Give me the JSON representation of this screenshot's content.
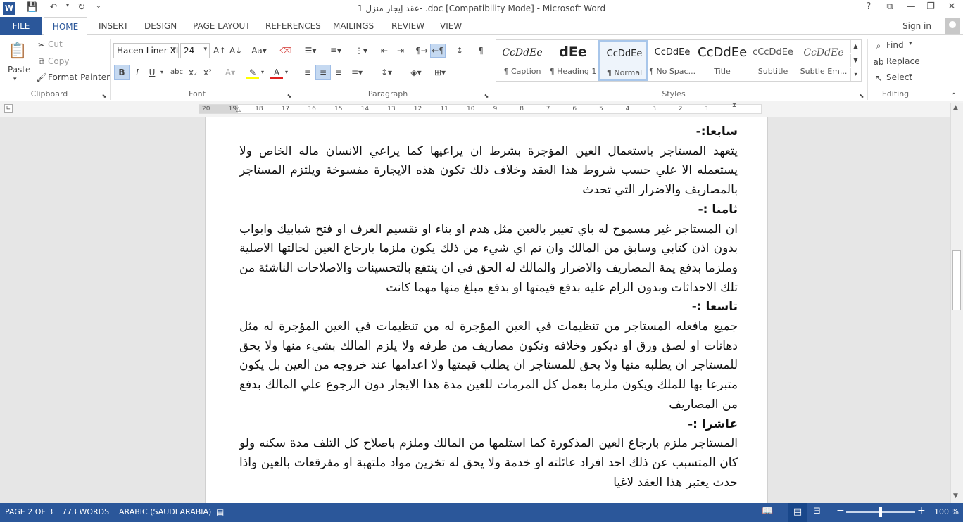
{
  "window": {
    "title": "عقد إيجار منزل 1- .doc [Compatibility Mode] - Microsoft Word",
    "qat_icons": [
      "word-app-icon",
      "save-icon",
      "undo-icon",
      "redo-icon",
      "customize-icon"
    ],
    "controls": {
      "help": "?",
      "ribbon_options": "⧉",
      "minimize": "—",
      "maximize": "❐",
      "close": "✕"
    }
  },
  "tabs": {
    "file": "FILE",
    "home": "HOME",
    "insert": "INSERT",
    "design": "DESIGN",
    "page_layout": "PAGE LAYOUT",
    "references": "REFERENCES",
    "mailings": "MAILINGS",
    "review": "REVIEW",
    "view": "VIEW",
    "sign_in": "Sign in"
  },
  "ribbon": {
    "clipboard": {
      "label": "Clipboard",
      "paste": "Paste",
      "cut": "Cut",
      "copy": "Copy",
      "format_painter": "Format Painter"
    },
    "font": {
      "label": "Font",
      "font_name": "Hacen Liner XL",
      "font_size": "24",
      "bold": "B",
      "italic": "I",
      "underline": "U",
      "strike": "abc",
      "subscript": "x₂",
      "superscript": "x²"
    },
    "paragraph": {
      "label": "Paragraph"
    },
    "styles": {
      "label": "Styles",
      "items": [
        {
          "preview": "CcDdEe",
          "name": "¶ Caption"
        },
        {
          "preview": "dEe",
          "name": "¶ Heading 1"
        },
        {
          "preview": "CcDdEe",
          "name": "¶ Normal"
        },
        {
          "preview": "CcDdEe",
          "name": "¶ No Spac..."
        },
        {
          "preview": "CcDdEe",
          "name": "Title"
        },
        {
          "preview": "cCcDdEe",
          "name": "Subtitle"
        },
        {
          "preview": "CcDdEe",
          "name": "Subtle Em..."
        }
      ]
    },
    "editing": {
      "label": "Editing",
      "find": "Find",
      "replace": "Replace",
      "select": "Select"
    }
  },
  "ruler": {
    "ticks": [
      "20",
      "19",
      "18",
      "17",
      "16",
      "15",
      "14",
      "13",
      "12",
      "11",
      "10",
      "9",
      "8",
      "7",
      "6",
      "5",
      "4",
      "3",
      "2",
      "1"
    ]
  },
  "document": {
    "paragraphs": [
      {
        "kind": "head",
        "text": "سابعا:-"
      },
      {
        "kind": "body",
        "text": "يتعهد المستاجر باستعمال العين المؤجرة بشرط ان يراعيها كما يراعي الانسان ماله الخاص ولا يستعمله الا علي حسب شروط هذا العقد وخلاف ذلك تكون هذه الايجارة مفسوخة ويلتزم المستاجر بالمصاريف والاضرار التي تحدث"
      },
      {
        "kind": "head",
        "text": "ثامنا :-"
      },
      {
        "kind": "body",
        "text": "ان المستاجر غير مسموح له باي تغيير بالعين مثل هدم او بناء او تقسيم الغرف او فتح شبابيك وابواب بدون اذن كتابي وسابق من المالك وان تم اي شيء من ذلك يكون ملزما بارجاع العين لحالتها الاصلية وملزما بدفع يمة المصاريف والاضرار والمالك له الحق في ان ينتفع بالتحسينات والاصلاحات الناشئة من تلك الاحداثات وبدون الزام عليه بدفع قيمتها او بدفع مبلغ منها مهما كانت"
      },
      {
        "kind": "head",
        "text": "تاسعا :-"
      },
      {
        "kind": "body",
        "text": "جميع مافعله المستاجر من تنظيمات في العين المؤجرة له من تنظيمات في العين المؤجرة له مثل دهانات او لصق ورق او ديكور وخلافه وتكون مصاريف من طرفه ولا يلزم المالك بشيء منها ولا يحق للمستاجر ان يطلبه منها ولا يحق للمستاجر ان يطلب قيمتها ولا اعدامها عند خروجه من العين بل يكون متبرعا بها للملك ويكون ملزما بعمل كل المرمات للعين مدة هذا الايجار دون الرجوع علي المالك بدفع من المصاريف"
      },
      {
        "kind": "head",
        "text": "عاشرا :-"
      },
      {
        "kind": "body",
        "text": "المستاجر ملزم بارجاع العين المذكورة كما استلمها من المالك وملزم باصلاح كل التلف مدة سكنه ولو كان المتسبب عن ذلك احد افراد عائلته او خدمة ولا يحق له تخزين مواد ملتهبة او مفرقعات بالعين واذا حدث يعتبر هذا العقد لاغيا"
      }
    ]
  },
  "status": {
    "page": "PAGE 2 OF 3",
    "words": "773 WORDS",
    "language": "ARABIC (SAUDI ARABIA)",
    "zoom": "100 %",
    "zoom_minus": "−",
    "zoom_plus": "+",
    "zoom_level": 1.0
  },
  "colors": {
    "accent": "#2b579a"
  }
}
